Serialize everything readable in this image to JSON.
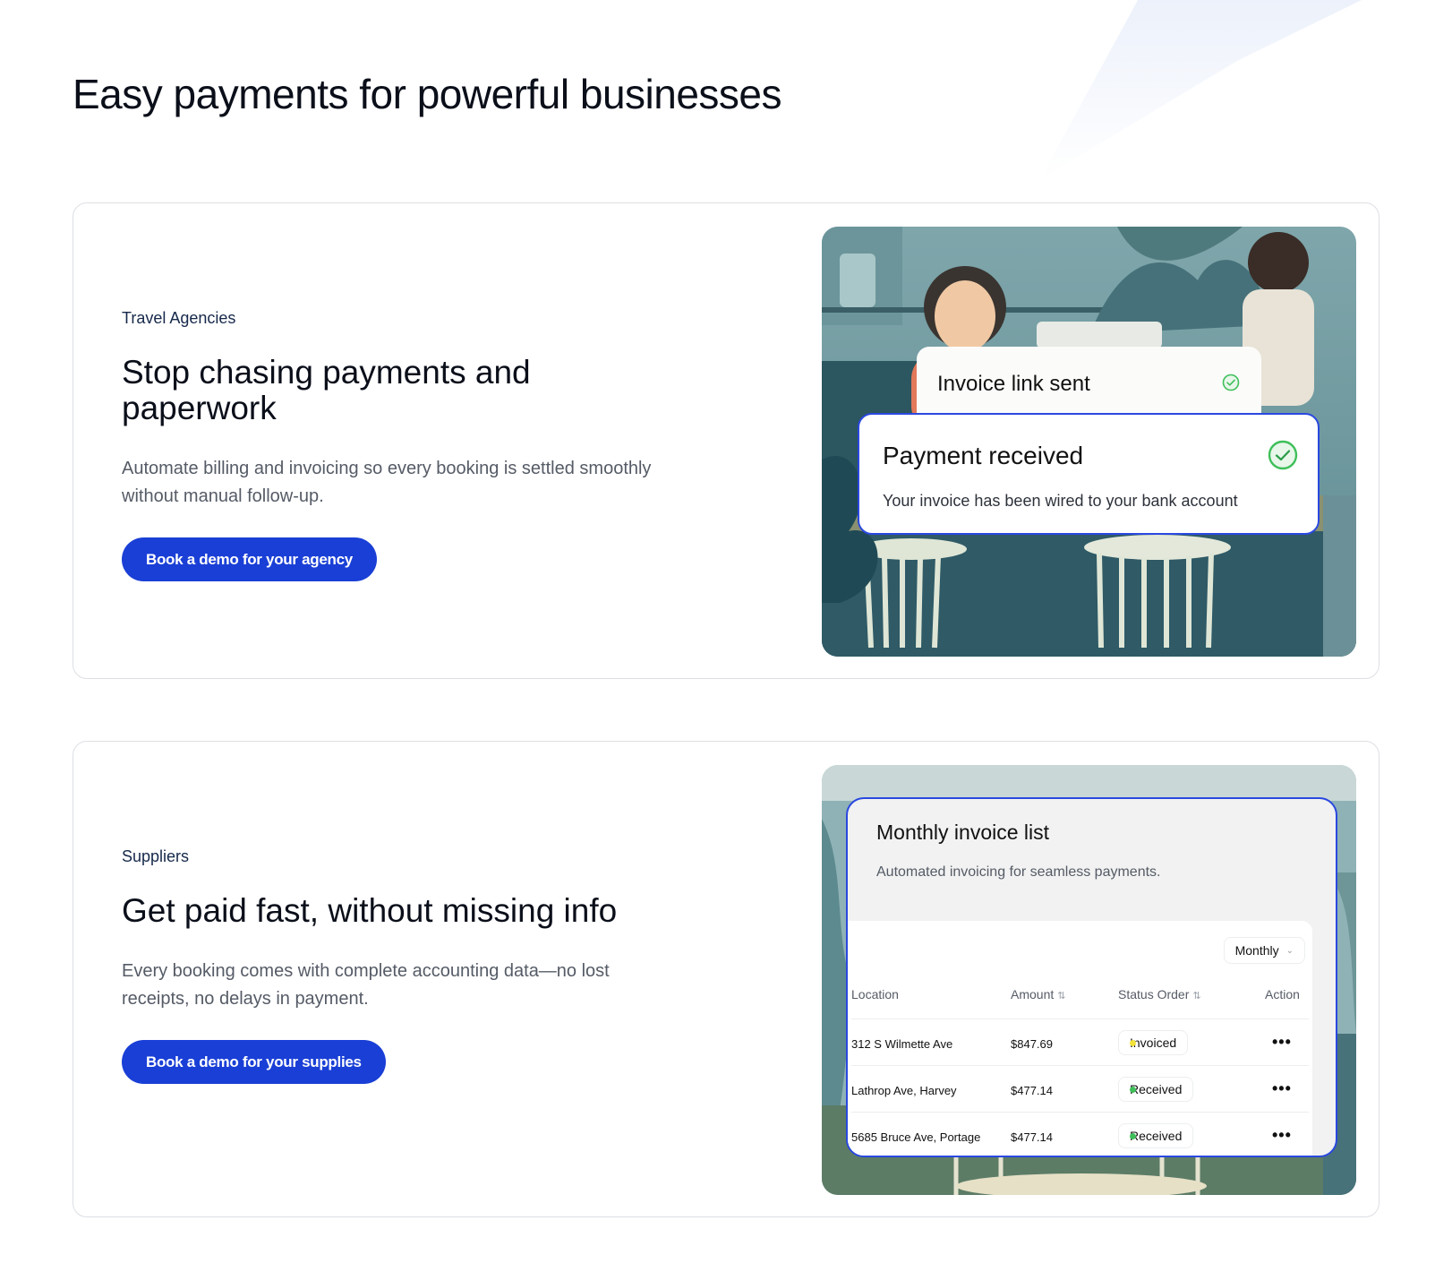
{
  "page": {
    "title": "Easy payments for powerful businesses"
  },
  "cards": [
    {
      "eyebrow": "Travel Agencies",
      "title": "Stop chasing payments and paperwork",
      "description": "Automate billing and invoicing so every booking is settled smoothly without manual follow-up.",
      "cta_label": "Book a demo for your agency",
      "visual": {
        "invoice_sent_label": "Invoice link sent",
        "payment_title": "Payment received",
        "payment_subtitle": "Your invoice has been wired to your bank account"
      }
    },
    {
      "eyebrow": "Suppliers",
      "title": "Get paid fast, without missing info",
      "description": "Every booking comes with complete accounting data—no lost receipts, no delays in payment.",
      "cta_label": "Book a demo for your supplies",
      "visual": {
        "title": "Monthly invoice list",
        "subtitle": "Automated invoicing for seamless payments.",
        "period": "Monthly",
        "columns": {
          "location": "Location",
          "amount": "Amount",
          "status": "Status Order",
          "action": "Action"
        },
        "rows": [
          {
            "location": "312 S Wilmette Ave",
            "amount": "$847.69",
            "status": "Invoiced",
            "status_color": "#f2e23a"
          },
          {
            "location": "Lathrop Ave, Harvey",
            "amount": "$477.14",
            "status": "Received",
            "status_color": "#3fbf5a"
          },
          {
            "location": "5685 Bruce Ave, Portage",
            "amount": "$477.14",
            "status": "Received",
            "status_color": "#3fbf5a"
          }
        ]
      }
    }
  ],
  "colors": {
    "primary_button": "#1a3fd6",
    "accent_border": "#2a48e0",
    "success_green": "#3fbf5a",
    "invoiced_yellow": "#f2e23a"
  }
}
